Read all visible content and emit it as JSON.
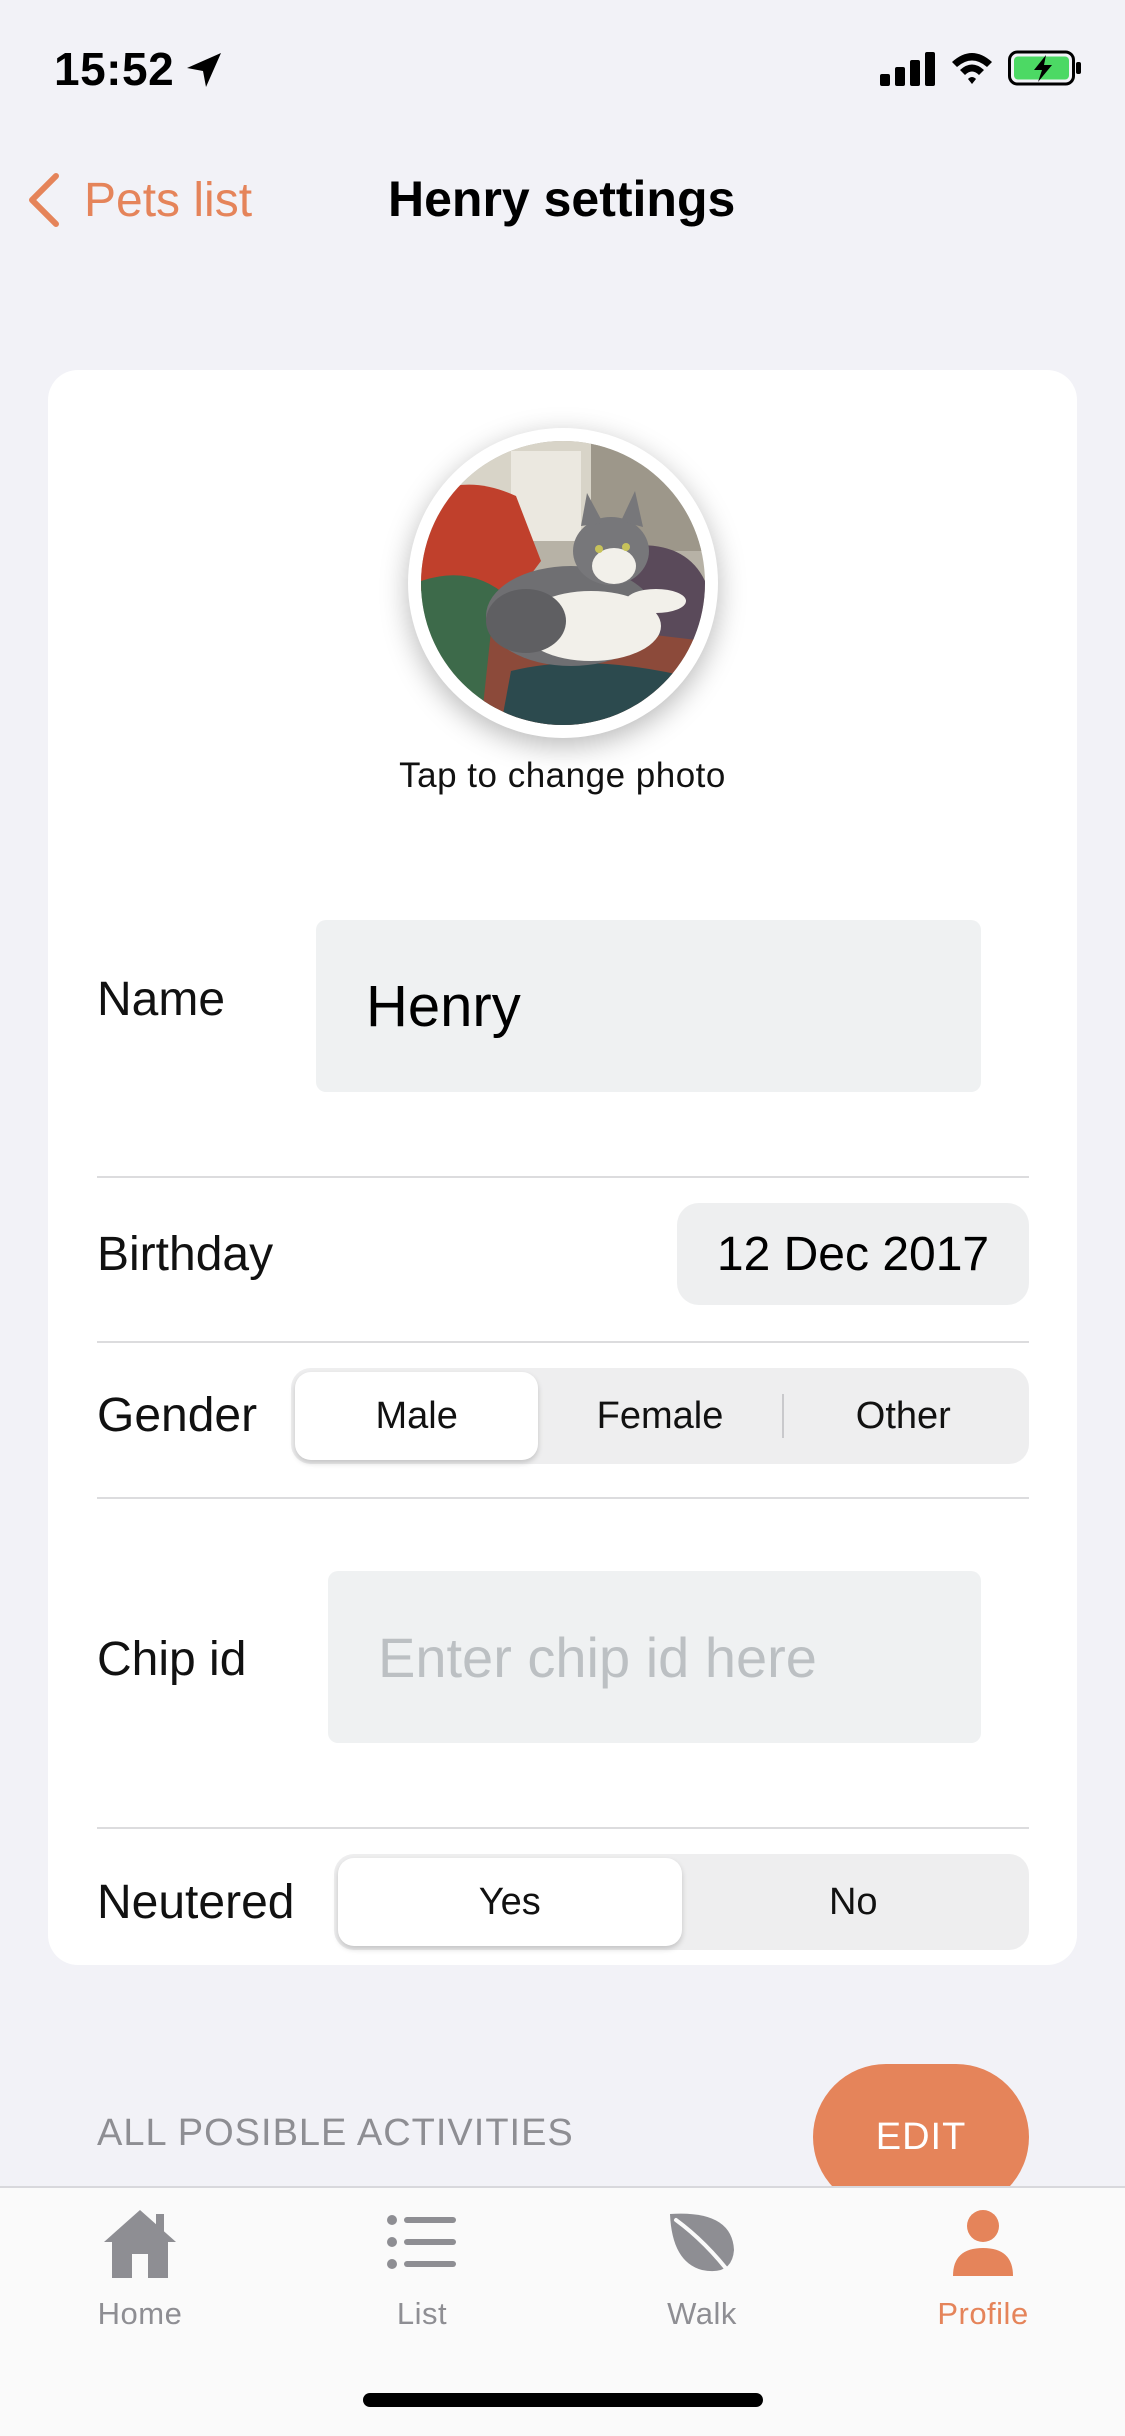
{
  "status_bar": {
    "time": "15:52",
    "icons": [
      "location-arrow-icon",
      "cellular-signal-icon",
      "wifi-icon",
      "battery-charging-icon"
    ]
  },
  "nav": {
    "back_label": "Pets list",
    "title": "Henry settings"
  },
  "profile": {
    "photo_caption": "Tap to change photo"
  },
  "form": {
    "name_label": "Name",
    "name_value": "Henry",
    "birthday_label": "Birthday",
    "birthday_value": "12 Dec 2017",
    "gender_label": "Gender",
    "gender_options": [
      "Male",
      "Female",
      "Other"
    ],
    "gender_selected": "Male",
    "chip_label": "Chip id",
    "chip_placeholder": "Enter chip id here",
    "chip_value": "",
    "neutered_label": "Neutered",
    "neutered_options": [
      "Yes",
      "No"
    ],
    "neutered_selected": "Yes"
  },
  "activities": {
    "label": "ALL POSIBLE ACTIVITIES",
    "edit_label": "EDIT"
  },
  "tabs": [
    {
      "label": "Home",
      "icon": "house-icon"
    },
    {
      "label": "List",
      "icon": "list-icon"
    },
    {
      "label": "Walk",
      "icon": "leaf-icon"
    },
    {
      "label": "Profile",
      "icon": "person-icon"
    }
  ],
  "active_tab": "Profile",
  "colors": {
    "accent": "#e5845a",
    "background": "#f2f2f7",
    "input_bg": "#eff1f2",
    "inactive_tab": "#8e8e93"
  }
}
